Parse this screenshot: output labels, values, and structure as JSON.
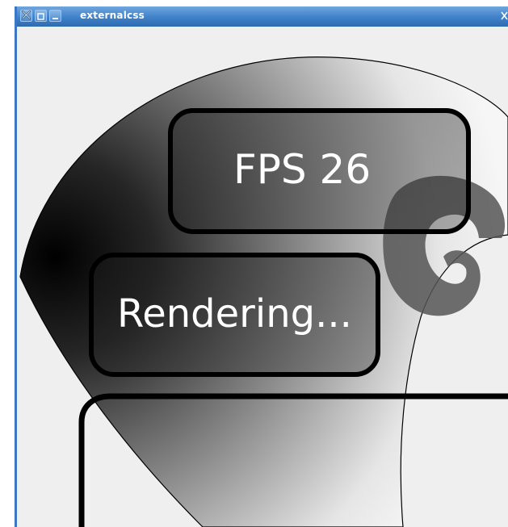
{
  "window": {
    "title": "externalcss"
  },
  "titlebar_icons": {
    "close": "close-x-icon",
    "maximize": "maximize-icon",
    "minimize": "minimize-icon"
  },
  "overlay": {
    "fps_label": "FPS 26",
    "status_label": "Rendering..."
  },
  "colors": {
    "titlebar": "#3f80c8",
    "background": "#efefef",
    "stroke": "#000000",
    "swirl": "#555555"
  }
}
